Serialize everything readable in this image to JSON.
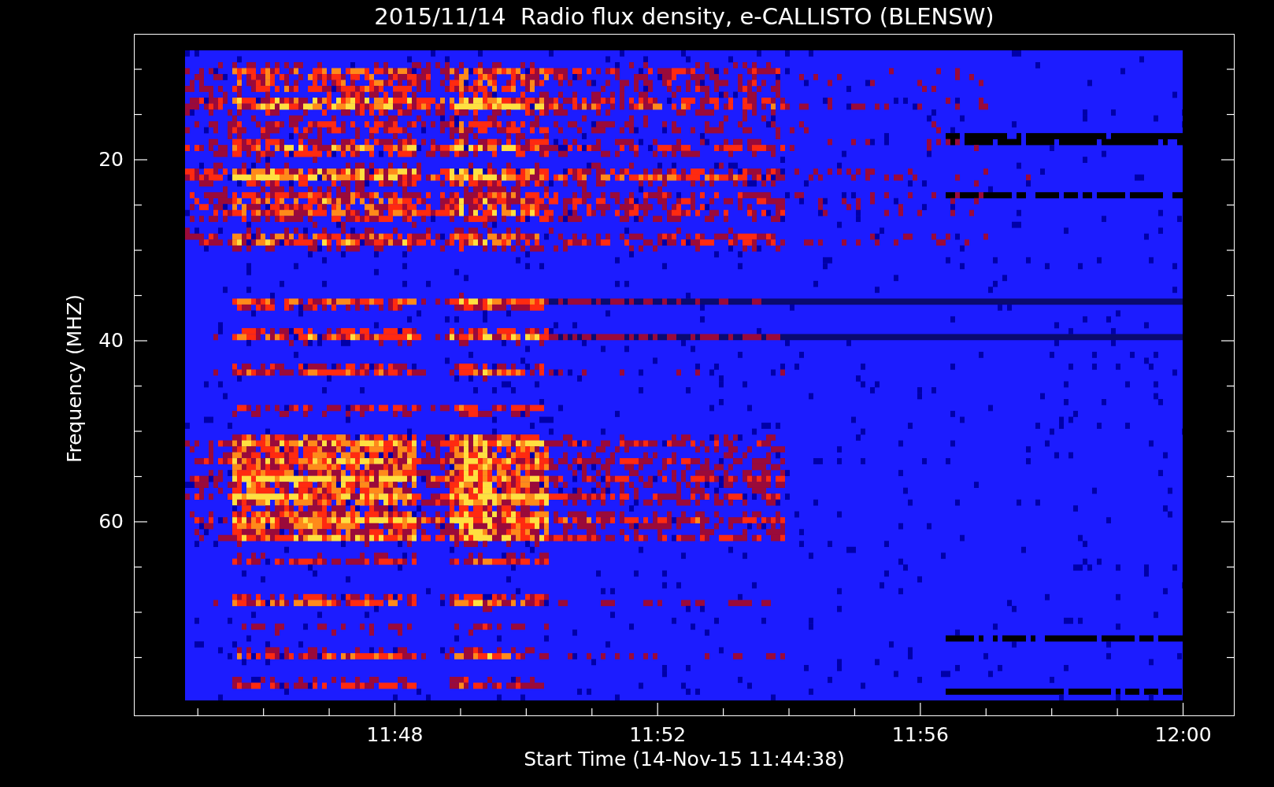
{
  "title": "2015/11/14  Radio flux density, e-CALLISTO (BLENSW)",
  "y_axis": {
    "label": "Frequency (MHZ)",
    "ticks": [
      "20",
      "40",
      "60"
    ]
  },
  "x_axis": {
    "label": "Start Time (14-Nov-15 11:44:38)",
    "ticks": [
      "11:48",
      "11:52",
      "11:56",
      "12:00"
    ]
  }
}
